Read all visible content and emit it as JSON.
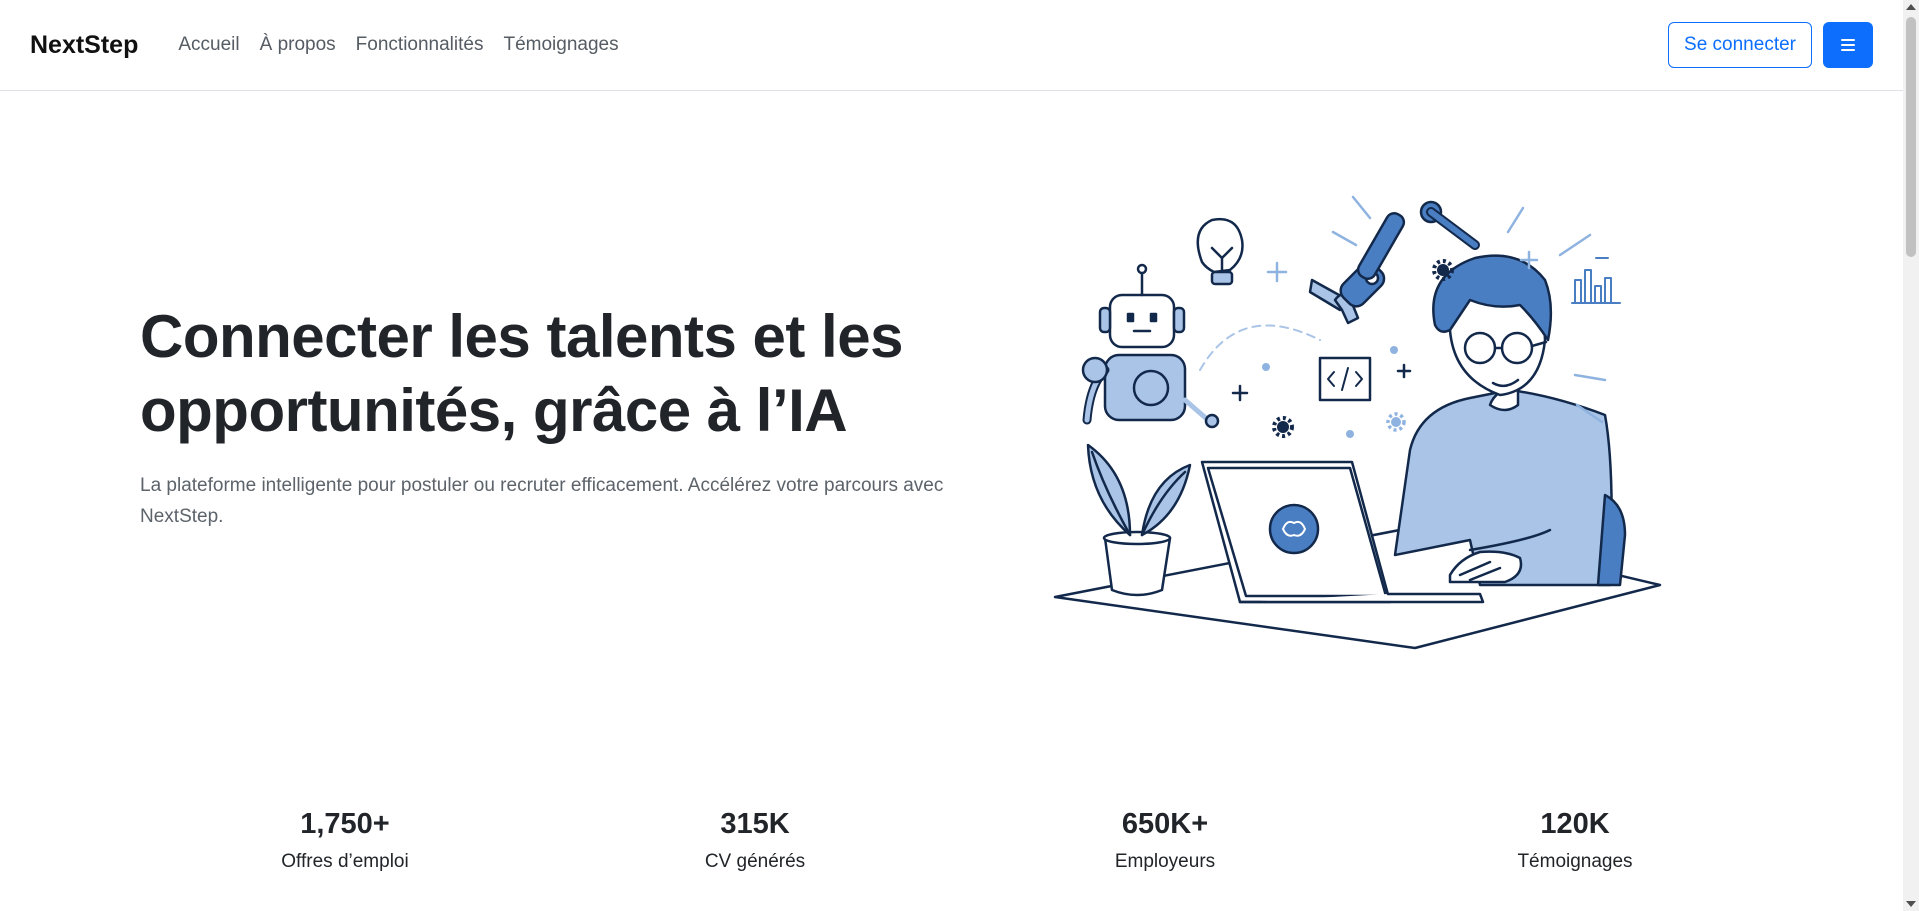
{
  "navbar": {
    "brand": "NextStep",
    "links": [
      "Accueil",
      "À propos",
      "Fonctionnalités",
      "Témoignages"
    ],
    "login_label": "Se connecter",
    "menu_icon": "hamburger-icon"
  },
  "hero": {
    "title": "Connecter les talents et les opportunités, grâce à l’IA",
    "subtitle": "La plateforme intelligente pour postuler ou recruter efficacement. Accélérez votre parcours avec NextStep."
  },
  "stats": [
    {
      "value": "1,750+",
      "label": "Offres d’emploi"
    },
    {
      "value": "315K",
      "label": "CV générés"
    },
    {
      "value": "650K+",
      "label": "Employeurs"
    },
    {
      "value": "120K",
      "label": "Témoignages"
    }
  ],
  "colors": {
    "primary": "#0d6efd",
    "illustration_dark": "#13294b",
    "illustration_mid": "#4a7ec2",
    "illustration_light": "#a9c4e6"
  }
}
